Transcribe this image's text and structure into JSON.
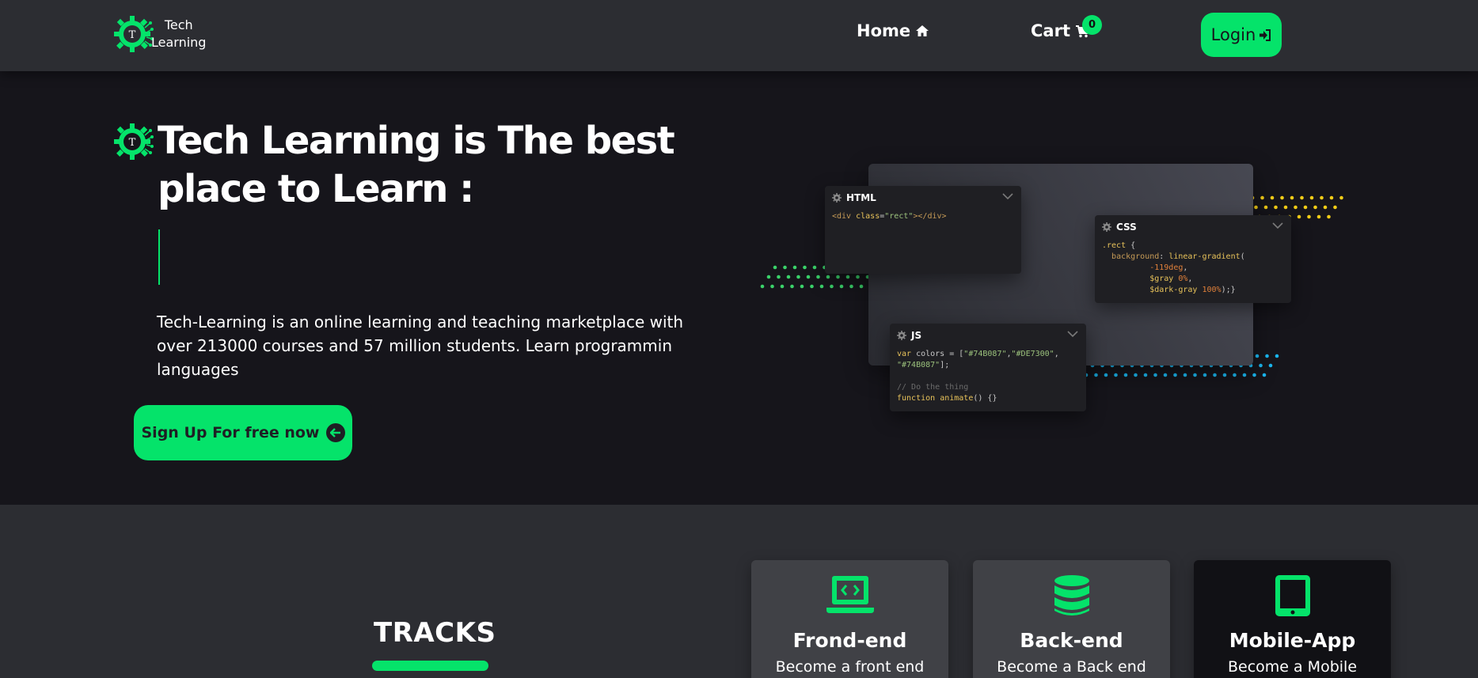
{
  "brand": {
    "line1": "Tech",
    "line2": "Learning"
  },
  "nav": {
    "home": "Home",
    "cart": "Cart",
    "cart_count": "0",
    "login": "Login"
  },
  "hero": {
    "title": "Tech Learning is The best place to Learn :",
    "description": "Tech-Learning is an online learning and teaching marketplace with over 213000 courses and 57 million students. Learn programmin languages",
    "signup": "Sign Up For free now"
  },
  "code_panels": {
    "html": {
      "title": "HTML"
    },
    "css": {
      "title": "CSS"
    },
    "js": {
      "title": "JS"
    }
  },
  "tracks": {
    "heading": "TRACKS",
    "cards": [
      {
        "title": "Frond-end",
        "subtitle": "Become a front end",
        "icon": "laptop-code-icon"
      },
      {
        "title": "Back-end",
        "subtitle": "Become a Back end",
        "icon": "database-icon"
      },
      {
        "title": "Mobile-App",
        "subtitle": "Become a Mobile",
        "icon": "tablet-icon"
      }
    ]
  },
  "colors": {
    "accent": "#05e36a",
    "navbar": "#2c2d32",
    "hero": "#16151b",
    "dots_yellow": "#f3cd17",
    "dots_blue": "#1ab7f0"
  }
}
